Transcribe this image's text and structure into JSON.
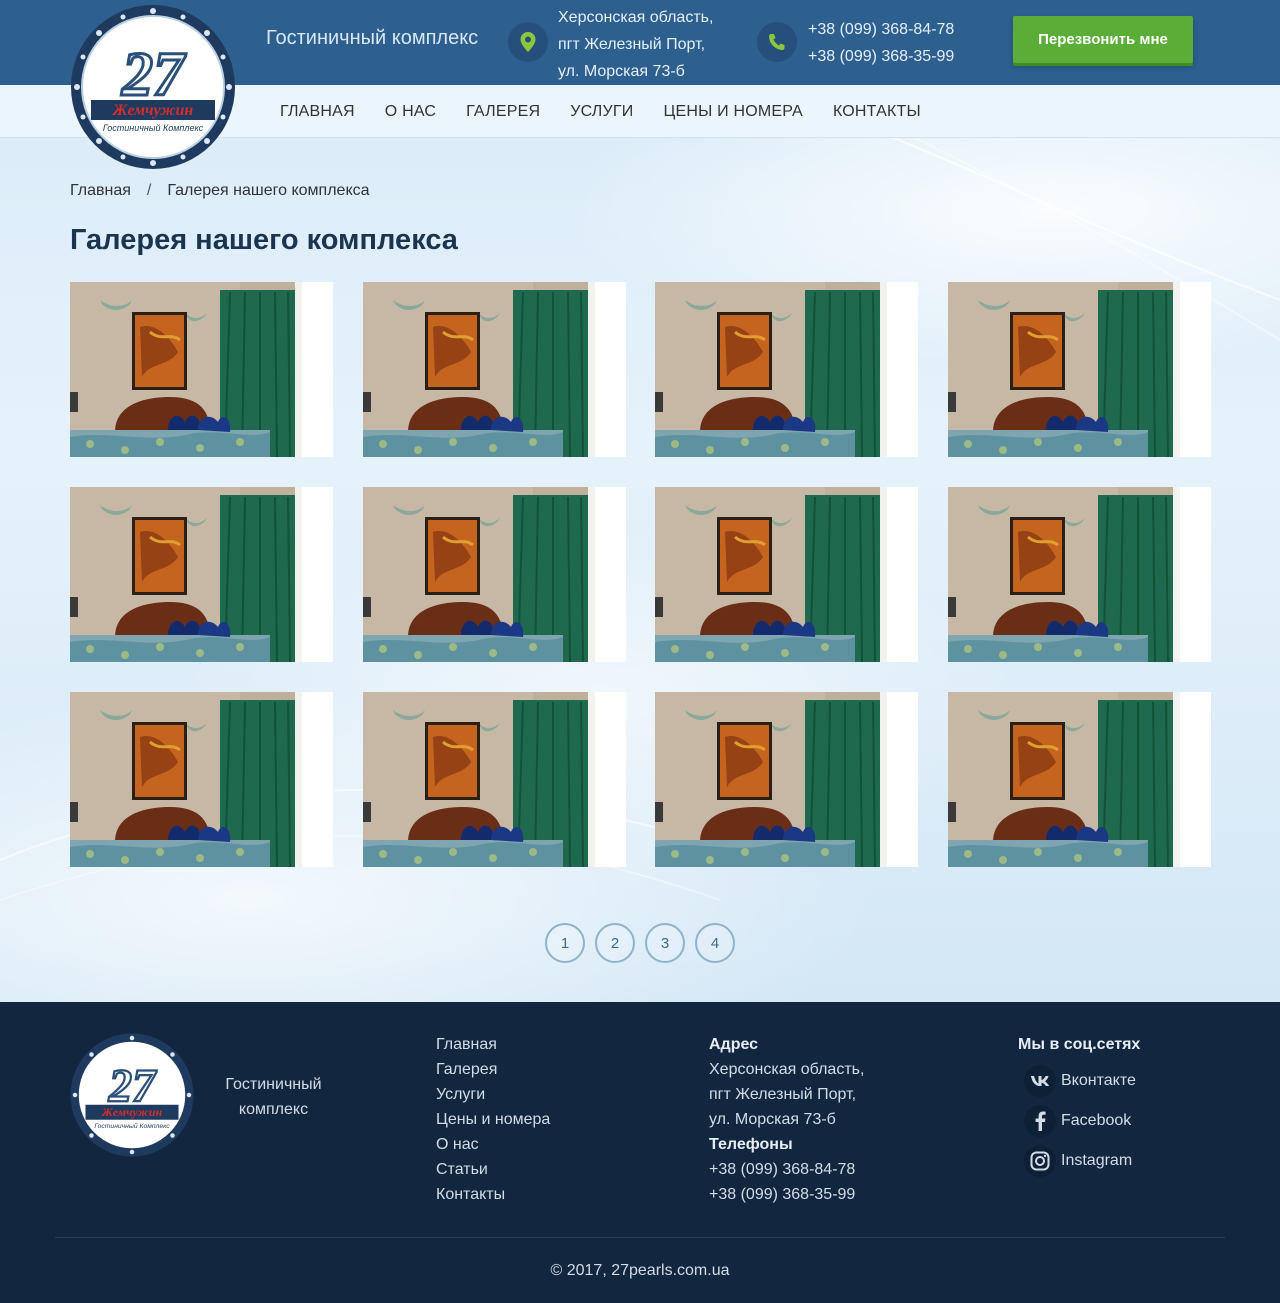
{
  "header": {
    "brand_text": "Гостиничный комплекс",
    "address_lines": [
      "Херсонская область,",
      "пгт Железный Порт,",
      "ул. Морская 73-б"
    ],
    "phones": [
      "+38 (099) 368-84-78",
      "+38 (099) 368-35-99"
    ],
    "callback_label": "Перезвонить мне",
    "logo": {
      "number": "27",
      "name": "Жемчужин",
      "subtitle": "Гостиничный Комплекс"
    }
  },
  "nav": {
    "items": [
      "ГЛАВНАЯ",
      "О НАС",
      "ГАЛЕРЕЯ",
      "УСЛУГИ",
      "ЦЕНЫ И НОМЕРА",
      "КОНТАКТЫ"
    ]
  },
  "breadcrumb": {
    "home": "Главная",
    "separator": "/",
    "current": "Галерея нашего комплекса"
  },
  "page_title": "Галерея нашего комплекса",
  "gallery": {
    "photo_count": 12,
    "columns": 4
  },
  "pagination": {
    "pages": [
      "1",
      "2",
      "3",
      "4"
    ]
  },
  "footer": {
    "brand_text": "Гостиничный комплекс",
    "links": [
      "Главная",
      "Галерея",
      "Услуги",
      "Цены и номера",
      "О нас",
      "Статьи",
      "Контакты"
    ],
    "address_heading": "Адрес",
    "address_lines": [
      "Херсонская область,",
      "пгт Железный Порт,",
      "ул. Морская 73-б"
    ],
    "phones_heading": "Телефоны",
    "phones": [
      "+38 (099) 368-84-78",
      "+38 (099) 368-35-99"
    ],
    "social_heading": "Мы в соц.сетях",
    "social": [
      {
        "label": "Вконтакте",
        "icon": "vk-icon"
      },
      {
        "label": "Facebook",
        "icon": "facebook-icon"
      },
      {
        "label": "Instagram",
        "icon": "instagram-icon"
      }
    ],
    "copyright": "© 2017, 27pearls.com.ua"
  },
  "colors": {
    "topbar": "#2d5f8f",
    "navbar": "#eaf5fd",
    "accent_green": "#5aad36",
    "footer_bg": "#12273f",
    "title": "#1b3550"
  }
}
